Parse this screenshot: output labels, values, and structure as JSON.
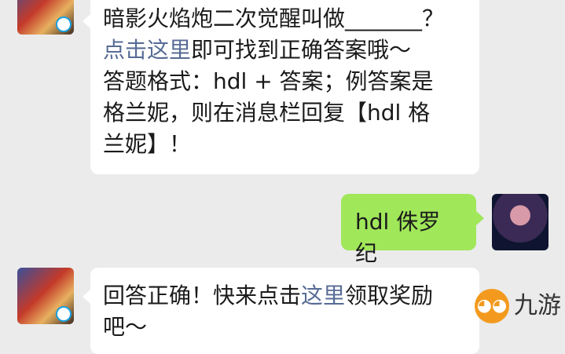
{
  "messages": [
    {
      "line1": "暗影火焰炮二次觉醒叫做_______？",
      "link": "点击这里",
      "line2_rest": "即可找到正确答案哦～",
      "line3": "答题格式：hdl + 答案；例答案是",
      "line4": "格兰妮，则在消息栏回复【hdl 格",
      "line5": "兰妮】！"
    },
    {
      "text": "hdl 侏罗纪"
    },
    {
      "prefix": "回答正确！快来点击",
      "link": "这里",
      "suffix": "领取奖励",
      "line2": "吧～"
    }
  ],
  "watermark": {
    "text": "九游",
    "icon": "nine-game-mascot-icon"
  },
  "colors": {
    "background": "#ebebeb",
    "bubble_in": "#ffffff",
    "bubble_out": "#a0e75a",
    "link": "#576b95"
  }
}
